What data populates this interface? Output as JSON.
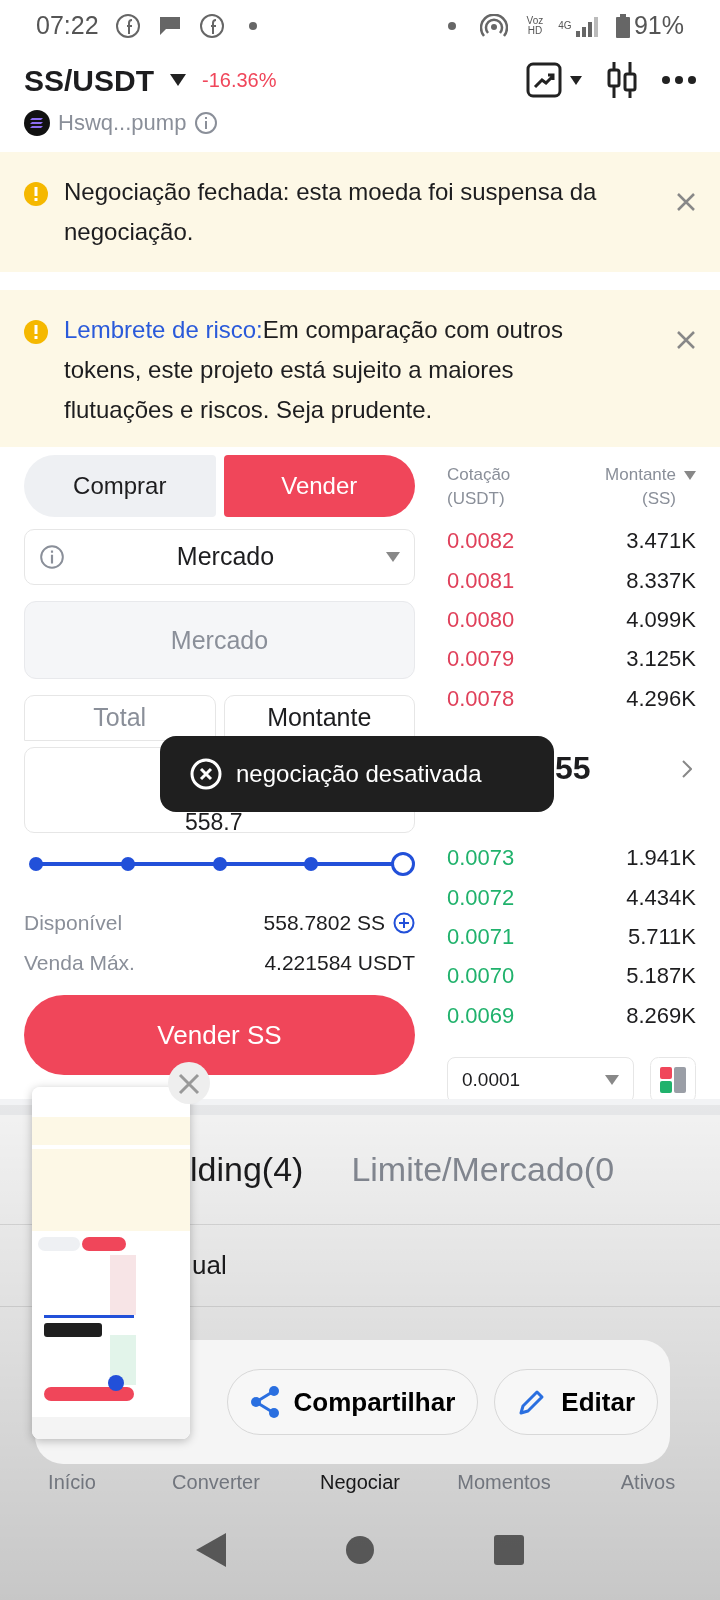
{
  "status_bar": {
    "time": "07:22",
    "voice": "Voz HD",
    "network": "4G",
    "battery": "91%"
  },
  "header": {
    "pair": "SS/USDT",
    "change": "-16.36%",
    "token": "Hswq...pump"
  },
  "alerts": [
    {
      "text": "Negociação fechada: esta moeda foi suspensa da negociação."
    },
    {
      "link": "Lembrete de risco:",
      "text": "Em comparação com outros tokens, este projeto está sujeito a maiores flutuações e riscos. Seja prudente."
    }
  ],
  "side_tabs": [
    {
      "label": "Comprar",
      "selected": false
    },
    {
      "label": "Vender",
      "selected": true
    }
  ],
  "order_type": "Mercado",
  "price_field": {
    "placeholder": "Mercado"
  },
  "amount_modes": [
    {
      "label": "Total",
      "selected": false
    },
    {
      "label": "Montante",
      "selected": true
    }
  ],
  "amount_field": {
    "value": "558.7"
  },
  "slider": {
    "level": 1
  },
  "available": {
    "label": "Disponível",
    "value": "558.7802 SS"
  },
  "max_sell": {
    "label": "Venda Máx.",
    "value": "4.221584 USDT"
  },
  "submit": "Vender SS",
  "order_book": {
    "columns": [
      {
        "label": "Cotação",
        "unit": "(USDT)"
      },
      {
        "label": "Montante",
        "unit": "(SS)"
      }
    ],
    "asks": [
      {
        "price": "0.0082",
        "amount": "3.471K"
      },
      {
        "price": "0.0081",
        "amount": "8.337K"
      },
      {
        "price": "0.0080",
        "amount": "4.099K"
      },
      {
        "price": "0.0079",
        "amount": "3.125K"
      },
      {
        "price": "0.0078",
        "amount": "4.296K"
      }
    ],
    "mid_price": "55",
    "bids": [
      {
        "price": "0.0073",
        "amount": "1.941K"
      },
      {
        "price": "0.0072",
        "amount": "4.434K"
      },
      {
        "price": "0.0071",
        "amount": "5.711K"
      },
      {
        "price": "0.0070",
        "amount": "5.187K"
      },
      {
        "price": "0.0069",
        "amount": "8.269K"
      }
    ],
    "precision": "0.0001"
  },
  "toast": "negociação desativada",
  "bottom_tabs": [
    {
      "label": "lding(4)",
      "selected": true
    },
    {
      "label": "Limite/Mercado(0",
      "selected": false
    }
  ],
  "filter": {
    "label": "ual"
  },
  "share_sheet": {
    "actions": [
      {
        "label": "Compartilhar",
        "kind": "share"
      },
      {
        "label": "Editar",
        "kind": "edit"
      }
    ]
  },
  "nav": [
    {
      "label": "Início",
      "selected": false
    },
    {
      "label": "Converter",
      "selected": false
    },
    {
      "label": "Negociar",
      "selected": true
    },
    {
      "label": "Momentos",
      "selected": false
    },
    {
      "label": "Ativos",
      "selected": false
    }
  ]
}
